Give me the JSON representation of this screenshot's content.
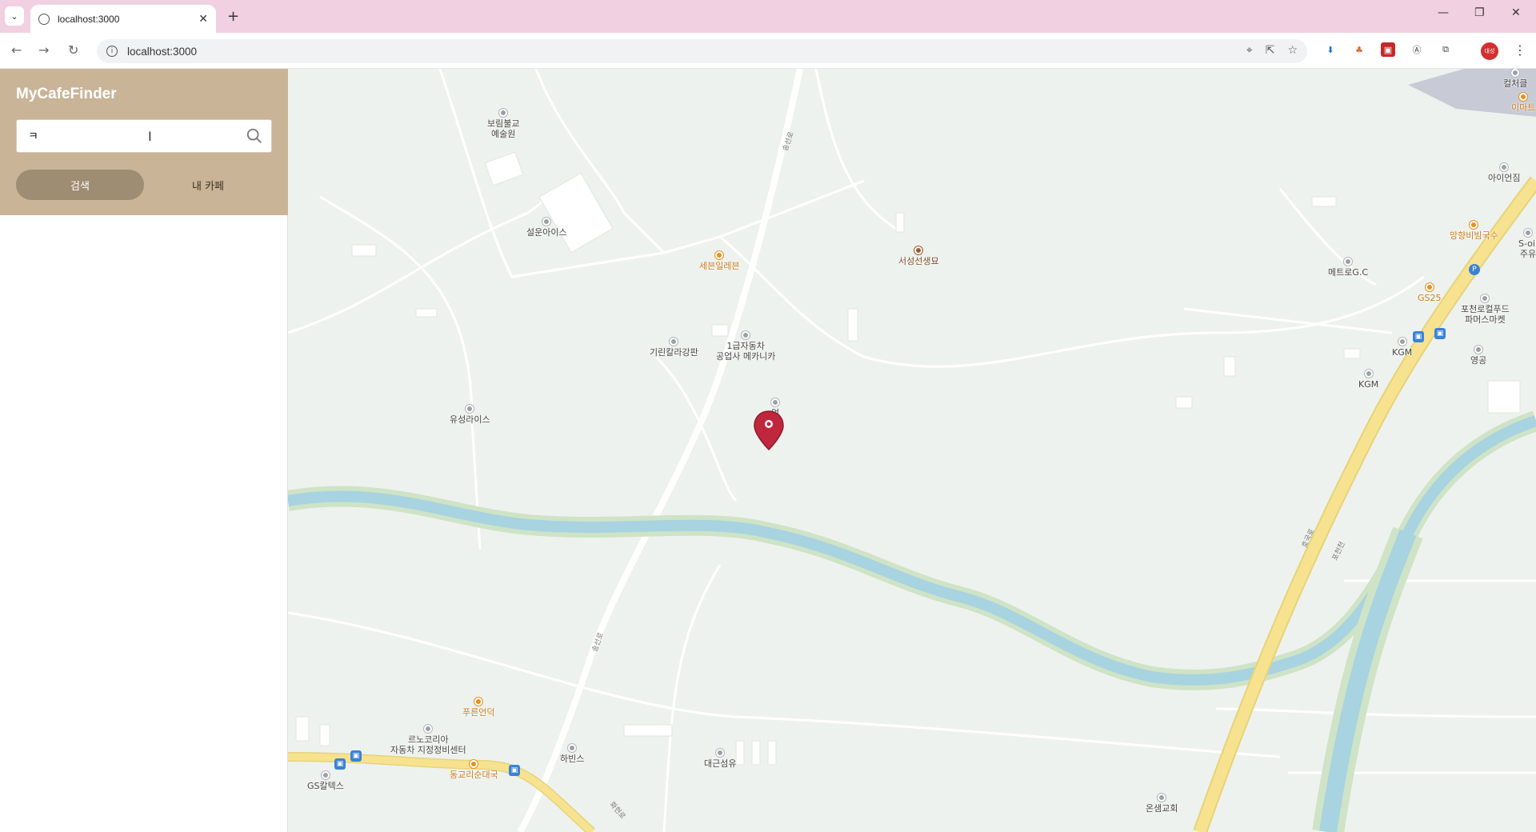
{
  "browser": {
    "tab_title": "localhost:3000",
    "new_tab": "+",
    "url": "localhost:3000",
    "controls": {
      "minimize": "—",
      "restore": "❐",
      "close": "✕"
    },
    "profile": "대성"
  },
  "app": {
    "brand": "MyCafeFinder",
    "search": {
      "value": "ㅋ",
      "placeholder": ""
    },
    "buttons": {
      "search": "검색",
      "my_cafe": "내 카페"
    }
  },
  "map": {
    "pois": [
      {
        "label": "보림불교\n예술원",
        "kind": "gray"
      },
      {
        "label": "설운아이스",
        "kind": "gray"
      },
      {
        "label": "세븐일레븐",
        "kind": "food"
      },
      {
        "label": "서성선생묘",
        "kind": "brown"
      },
      {
        "label": "기린칼라강판",
        "kind": "gray"
      },
      {
        "label": "1급자동차\n공업사 메카니카",
        "kind": "gray"
      },
      {
        "label": "유성라이스",
        "kind": "gray"
      },
      {
        "label": "업",
        "kind": "gray"
      },
      {
        "label": "컬처클",
        "kind": "gray"
      },
      {
        "label": "이마트",
        "kind": "food"
      },
      {
        "label": "아이언짐",
        "kind": "gray"
      },
      {
        "label": "망향비빔국수",
        "kind": "food"
      },
      {
        "label": "S-oil\n주유",
        "kind": "gray"
      },
      {
        "label": "메트로G.C",
        "kind": "gray"
      },
      {
        "label": "GS25",
        "kind": "food"
      },
      {
        "label": "포천로컬푸드\n파머스마켓",
        "kind": "gray"
      },
      {
        "label": "KGM",
        "kind": "gray"
      },
      {
        "label": "KGM",
        "kind": "gray"
      },
      {
        "label": "영공",
        "kind": "gray"
      },
      {
        "label": "푸른언덕",
        "kind": "food"
      },
      {
        "label": "르노코리아\n자동차 지정정비센터",
        "kind": "gray"
      },
      {
        "label": "하빈스",
        "kind": "gray"
      },
      {
        "label": "동교리순대국",
        "kind": "food"
      },
      {
        "label": "GS칼텍스",
        "kind": "gray"
      },
      {
        "label": "대근섬유",
        "kind": "gray"
      },
      {
        "label": "온샘교회",
        "kind": "gray"
      }
    ],
    "road_labels": [
      "송선로",
      "송선로",
      "호국로",
      "포천천",
      "화현로"
    ]
  }
}
